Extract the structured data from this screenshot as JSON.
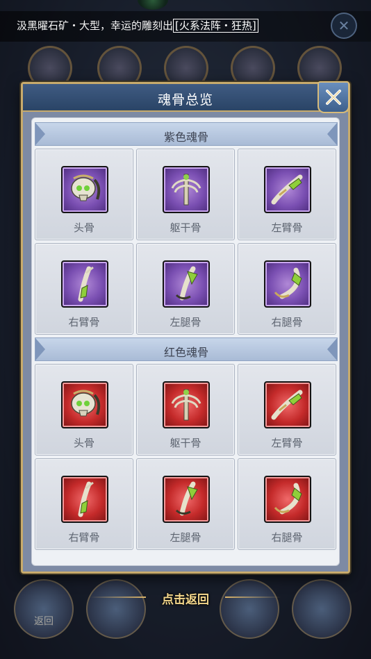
{
  "ticker": {
    "text": "汲黑曜石矿・大型，幸运的雕刻出",
    "highlight": "[火系法阵・狂热]"
  },
  "modal": {
    "title": "魂骨总览",
    "sections": [
      {
        "title": "紫色魂骨",
        "rarity": "purple",
        "items": [
          {
            "label": "头骨",
            "icon": "skull-icon"
          },
          {
            "label": "躯干骨",
            "icon": "torso-bone-icon"
          },
          {
            "label": "左臂骨",
            "icon": "left-arm-bone-icon"
          },
          {
            "label": "右臂骨",
            "icon": "right-arm-bone-icon"
          },
          {
            "label": "左腿骨",
            "icon": "left-leg-bone-icon"
          },
          {
            "label": "右腿骨",
            "icon": "right-leg-bone-icon"
          }
        ]
      },
      {
        "title": "红色魂骨",
        "rarity": "red",
        "items": [
          {
            "label": "头骨",
            "icon": "skull-icon"
          },
          {
            "label": "躯干骨",
            "icon": "torso-bone-icon"
          },
          {
            "label": "左臂骨",
            "icon": "left-arm-bone-icon"
          },
          {
            "label": "右臂骨",
            "icon": "right-arm-bone-icon"
          },
          {
            "label": "左腿骨",
            "icon": "left-leg-bone-icon"
          },
          {
            "label": "右腿骨",
            "icon": "right-leg-bone-icon"
          }
        ]
      }
    ]
  },
  "back_hint": "点击返回",
  "bottom_bar": {
    "items": [
      "返回"
    ]
  },
  "colors": {
    "purple_frame": "#7a4fb2",
    "red_frame": "#c42a2a",
    "gold_border": "#c8ab6c",
    "header_blue": "#2a4466"
  }
}
